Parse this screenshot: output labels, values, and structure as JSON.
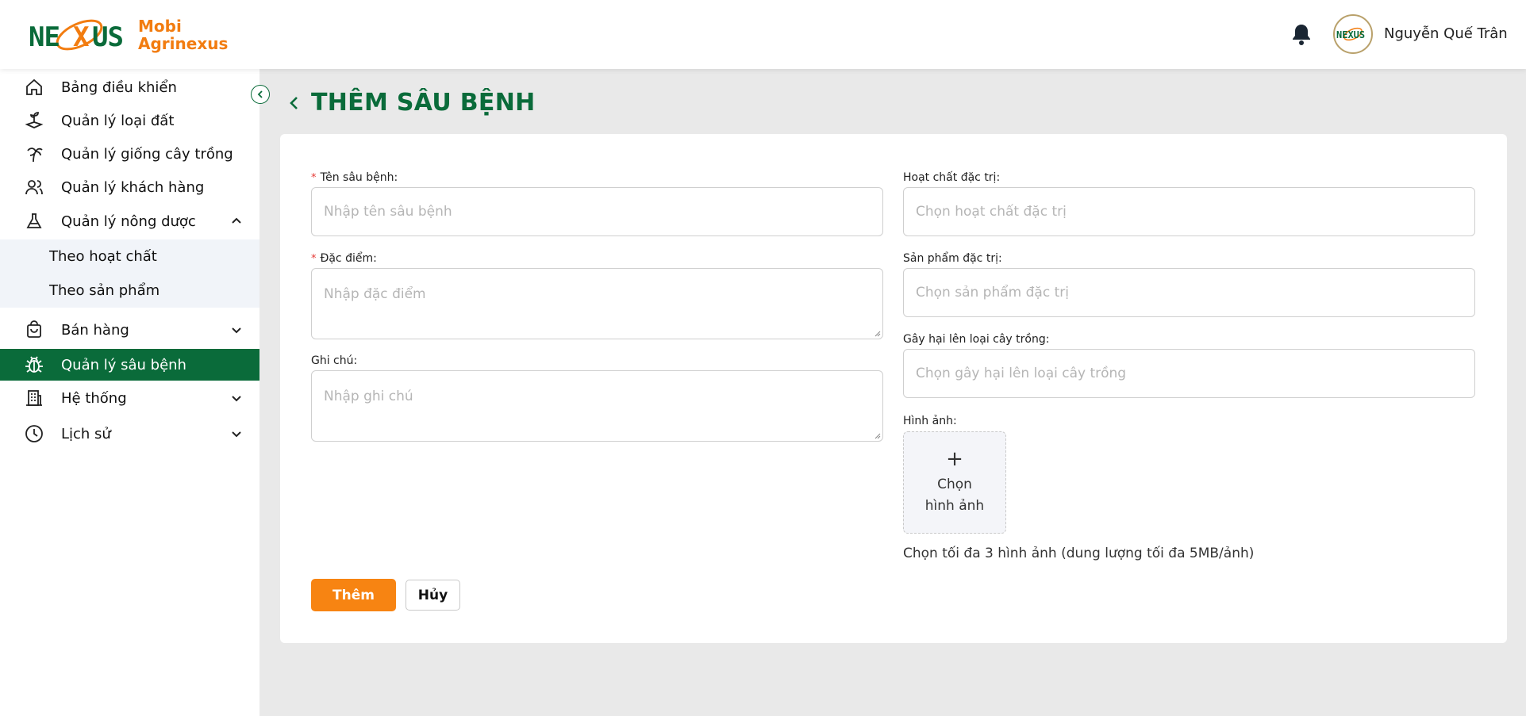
{
  "brand": {
    "line1": "Mobi",
    "line2": "Agrinexus",
    "logo_text": "NEXUS",
    "accent": "#f27c10",
    "green": "#0a6b3a"
  },
  "header": {
    "user_name": "Nguyễn Quế Trân",
    "avatar_text": "NEXUS"
  },
  "sidebar": {
    "items": [
      {
        "label": "Bảng điều khiển",
        "icon": "home-icon"
      },
      {
        "label": "Quản lý loại đất",
        "icon": "soil-icon"
      },
      {
        "label": "Quản lý giống cây trồng",
        "icon": "palm-tree-icon"
      },
      {
        "label": "Quản lý khách hàng",
        "icon": "users-icon"
      },
      {
        "label": "Quản lý nông dược",
        "icon": "flask-icon",
        "expanded": true
      },
      {
        "label": "Bán hàng",
        "icon": "shopping-bag-icon"
      },
      {
        "label": "Quản lý sâu bệnh",
        "icon": "bug-icon",
        "active": true
      },
      {
        "label": "Hệ thống",
        "icon": "building-icon"
      },
      {
        "label": "Lịch sử",
        "icon": "history-icon"
      }
    ],
    "sub_items": [
      {
        "label": "Theo hoạt chất"
      },
      {
        "label": "Theo sản phẩm"
      }
    ]
  },
  "page": {
    "title": "THÊM SÂU BỆNH",
    "form": {
      "name": {
        "label": "Tên sâu bệnh:",
        "placeholder": "Nhập tên sâu bệnh",
        "required": true
      },
      "feature": {
        "label": "Đặc điểm:",
        "placeholder": "Nhập đặc điểm",
        "required": true
      },
      "note": {
        "label": "Ghi chú:",
        "placeholder": "Nhập ghi chú"
      },
      "active_ingredient": {
        "label": "Hoạt chất đặc trị:",
        "placeholder": "Chọn hoạt chất đặc trị"
      },
      "product": {
        "label": "Sản phẩm đặc trị:",
        "placeholder": "Chọn sản phẩm đặc trị"
      },
      "crop": {
        "label": "Gây hại lên loại cây trồng:",
        "placeholder": "Chọn gây hại lên loại cây trồng"
      },
      "image": {
        "label": "Hình ảnh:",
        "upload_line1": "Chọn",
        "upload_line2": "hình ảnh",
        "plus": "+",
        "hint": "Chọn tối đa 3 hình ảnh (dung lượng tối đa 5MB/ảnh)"
      }
    },
    "buttons": {
      "submit": "Thêm",
      "cancel": "Hủy"
    }
  }
}
